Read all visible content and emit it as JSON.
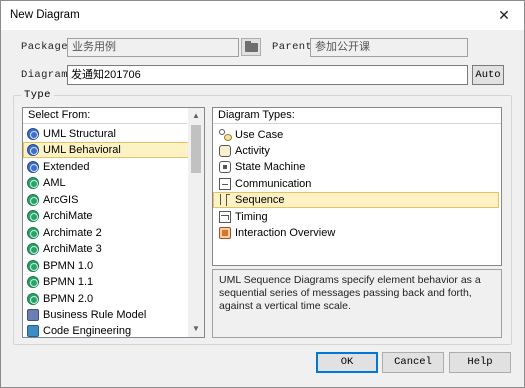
{
  "window": {
    "title": "New Diagram",
    "close_glyph": "✕"
  },
  "form": {
    "package_label": "Package",
    "package_value": "业务用例",
    "parent_label": "Parent",
    "parent_value": "参加公开课",
    "diagram_label": "Diagram",
    "diagram_value": "发通知201706",
    "auto_label": "Auto"
  },
  "type_group": {
    "legend": "Type",
    "select_from_header": "Select From:",
    "select_from_items": [
      {
        "label": "UML Structural",
        "icon": "globe-icon"
      },
      {
        "label": "UML Behavioral",
        "icon": "globe-icon",
        "selected": true
      },
      {
        "label": "Extended",
        "icon": "globe-icon"
      },
      {
        "label": "AML",
        "icon": "green-globe-icon"
      },
      {
        "label": "ArcGIS",
        "icon": "green-globe-icon"
      },
      {
        "label": "ArchiMate",
        "icon": "green-globe-icon"
      },
      {
        "label": "Archimate 2",
        "icon": "green-globe-icon"
      },
      {
        "label": "ArchiMate 3",
        "icon": "green-globe-icon"
      },
      {
        "label": "BPMN 1.0",
        "icon": "green-globe-icon"
      },
      {
        "label": "BPMN 1.1",
        "icon": "green-globe-icon"
      },
      {
        "label": "BPMN 2.0",
        "icon": "green-globe-icon"
      },
      {
        "label": "Business Rule Model",
        "icon": "business-rule-icon"
      },
      {
        "label": "Code Engineering",
        "icon": "code-icon"
      }
    ],
    "diagram_types_header": "Diagram Types:",
    "diagram_types": [
      {
        "label": "Use Case",
        "icon": "use-case-icon"
      },
      {
        "label": "Activity",
        "icon": "activity-icon"
      },
      {
        "label": "State Machine",
        "icon": "state-machine-icon"
      },
      {
        "label": "Communication",
        "icon": "communication-icon"
      },
      {
        "label": "Sequence",
        "icon": "sequence-icon",
        "selected": true
      },
      {
        "label": "Timing",
        "icon": "timing-icon"
      },
      {
        "label": "Interaction Overview",
        "icon": "interaction-overview-icon"
      }
    ],
    "description": "UML Sequence Diagrams specify element behavior as a sequential series of messages passing back and forth, against a vertical time scale."
  },
  "buttons": {
    "ok": "OK",
    "cancel": "Cancel",
    "help": "Help"
  },
  "colors": {
    "selection_bg": "#fcf2c4",
    "selection_border": "#e5c365",
    "default_button_border": "#0078d7"
  }
}
